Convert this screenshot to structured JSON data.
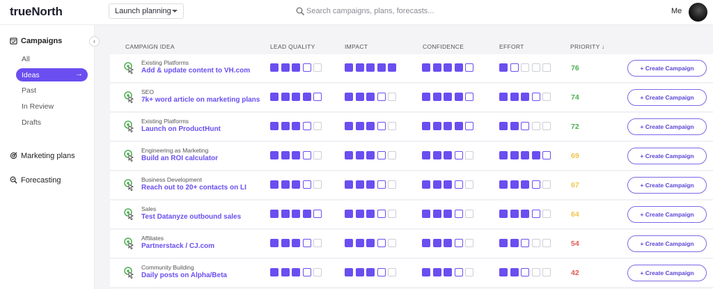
{
  "app": {
    "logo": "trueNorth"
  },
  "header": {
    "plan_select": "Launch planning",
    "search_placeholder": "Search campaigns, plans, forecasts...",
    "user_label": "Me"
  },
  "sidebar": {
    "campaigns_label": "Campaigns",
    "items": [
      {
        "label": "All",
        "active": false
      },
      {
        "label": "Ideas",
        "active": true
      },
      {
        "label": "Past",
        "active": false
      },
      {
        "label": "In Review",
        "active": false
      },
      {
        "label": "Drafts",
        "active": false
      }
    ],
    "marketing_plans_label": "Marketing plans",
    "forecasting_label": "Forecasting",
    "active_arrow": "→",
    "collapse_glyph": "‹"
  },
  "table": {
    "headers": [
      "CAMPAIGN IDEA",
      "LEAD QUALITY",
      "IMPACT",
      "CONFIDENCE",
      "EFFORT",
      "PRIORITY ↓"
    ],
    "button_label": "+ Create Campaign",
    "accent_color": "#6b4ef0",
    "priority_colors": {
      "green": "#4caf50",
      "yellow": "#f0c44a",
      "red": "#e05a4f"
    },
    "rows": [
      {
        "category": "Existing Platforms",
        "title": "Add & update content to VH.com",
        "lead_quality": 3,
        "impact": 5,
        "confidence": 4,
        "effort": 1,
        "priority": "76",
        "priority_color": "green"
      },
      {
        "category": "SEO",
        "title": "7k+ word article on marketing plans",
        "lead_quality": 4,
        "impact": 3,
        "confidence": 4,
        "effort": 3,
        "priority": "74",
        "priority_color": "green"
      },
      {
        "category": "Existing Platforms",
        "title": "Launch on ProductHunt",
        "lead_quality": 3,
        "impact": 3,
        "confidence": 4,
        "effort": 2,
        "priority": "72",
        "priority_color": "green"
      },
      {
        "category": "Engineering as Marketing",
        "title": "Build an ROI calculator",
        "lead_quality": 3,
        "impact": 3,
        "confidence": 3,
        "effort": 4,
        "priority": "69",
        "priority_color": "yellow"
      },
      {
        "category": "Business Development",
        "title": "Reach out to 20+ contacts on LI",
        "lead_quality": 3,
        "impact": 3,
        "confidence": 3,
        "effort": 3,
        "priority": "67",
        "priority_color": "yellow"
      },
      {
        "category": "Sales",
        "title": "Test Datanyze outbound sales",
        "lead_quality": 4,
        "impact": 3,
        "confidence": 3,
        "effort": 3,
        "priority": "64",
        "priority_color": "yellow"
      },
      {
        "category": "Affiliates",
        "title": "Partnerstack / CJ.com",
        "lead_quality": 3,
        "impact": 3,
        "confidence": 3,
        "effort": 2,
        "priority": "54",
        "priority_color": "red"
      },
      {
        "category": "Community Building",
        "title": "Daily posts on Alpha/Beta",
        "lead_quality": 3,
        "impact": 3,
        "confidence": 3,
        "effort": 2,
        "priority": "42",
        "priority_color": "red"
      }
    ]
  }
}
